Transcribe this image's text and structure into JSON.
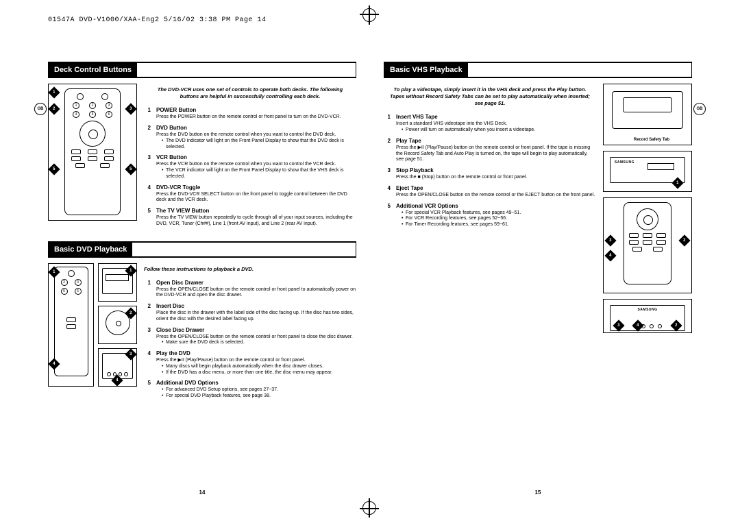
{
  "header": "01547A DVD-V1000/XAA-Eng2  5/16/02 3:38 PM  Page 14",
  "gb": "GB",
  "pages": {
    "left": "14",
    "right": "15"
  },
  "left_page": {
    "section1": {
      "title": "Deck Control Buttons",
      "intro": "The DVD-VCR uses one set of controls to operate both decks. The following buttons are helpful in successfully controlling each deck.",
      "steps": [
        {
          "n": "1",
          "title": "POWER Button",
          "text": "Press the POWER button on the remote control or front panel to turn on the DVD-VCR."
        },
        {
          "n": "2",
          "title": "DVD Button",
          "text": "Press the DVD button on the remote control when you want to control the DVD deck.",
          "bullets": [
            "The DVD indicator will light on the Front Panel Display to show that the DVD deck is selected."
          ]
        },
        {
          "n": "3",
          "title": "VCR Button",
          "text": "Press the VCR button on the remote control when you want to control the VCR deck.",
          "bullets": [
            "The VCR indicator will light on the Front Panel Display to show that the VHS deck is selected."
          ]
        },
        {
          "n": "4",
          "title": "DVD-VCR Toggle",
          "text": "Press the DVD-VCR SELECT button on the front panel to toggle control between the DVD deck and the VCR deck."
        },
        {
          "n": "5",
          "title": "The TV VIEW Button",
          "text": "Press the TV VIEW button repeatedly to cycle through all of your input sources, including the DVD, VCR, Tuner (Ch##), Line 1 (front AV input), and Line 2 (rear AV input)."
        }
      ]
    },
    "section2": {
      "title": "Basic DVD Playback",
      "intro": "Follow these instructions to playback a DVD.",
      "steps": [
        {
          "n": "1",
          "title": "Open Disc Drawer",
          "text": "Press the OPEN/CLOSE button on the remote control or front panel to automatically power on the DVD-VCR and open the disc drawer."
        },
        {
          "n": "2",
          "title": "Insert Disc",
          "text": "Place the disc in the drawer with the label side of the disc facing up. If the disc has two sides, orient the disc with the desired label facing up."
        },
        {
          "n": "3",
          "title": "Close Disc Drawer",
          "text": "Press the OPEN/CLOSE button on the remote control or front panel to close the disc drawer.",
          "bullets": [
            "Make sure the DVD deck is selected."
          ]
        },
        {
          "n": "4",
          "title": "Play the DVD",
          "text": "Press the ▶II (Play/Pause) button on the remote control or front panel.",
          "bullets": [
            "Many discs will begin playback automatically when the disc drawer closes.",
            "If the DVD has a disc menu, or more than one title, the disc menu may appear."
          ]
        },
        {
          "n": "5",
          "title": "Additional DVD Options",
          "bullets": [
            "For advanced DVD Setup options, see pages 27~37.",
            "For special DVD Playback features, see page 38."
          ]
        }
      ]
    }
  },
  "right_page": {
    "section1": {
      "title": "Basic VHS Playback",
      "intro": "To play a videotape, simply insert it in the VHS deck and press the Play button. Tapes without Record Safety Tabs can be set to play automatically when inserted; see page 51.",
      "steps": [
        {
          "n": "1",
          "title": "Insert VHS Tape",
          "text": "Insert a standard VHS videotape into the VHS Deck.",
          "bullets": [
            "Power will turn on automatically when you insert a videotape."
          ]
        },
        {
          "n": "2",
          "title": "Play Tape",
          "text": "Press the ▶II (Play/Pause) button on the remote control or front panel. If the tape is missing the Record Safety Tab and Auto Play is turned on, the tape will begin to play automatically, see page 51."
        },
        {
          "n": "3",
          "title": "Stop Playback",
          "text": "Press the ■ (Stop) button on the remote control or front panel."
        },
        {
          "n": "4",
          "title": "Eject Tape",
          "text": "Press the OPEN/CLOSE button on the remote control or the EJECT button on the front panel."
        },
        {
          "n": "5",
          "title": "Additional VCR Options",
          "bullets": [
            "For special VCR Playback features, see pages 49~51.",
            "For VCR Recording features, see pages 52~56.",
            "For Timer Recording features, see pages 59~61."
          ]
        }
      ],
      "tape_label": "Record Safety Tab",
      "brand": "SAMSUNG"
    }
  }
}
